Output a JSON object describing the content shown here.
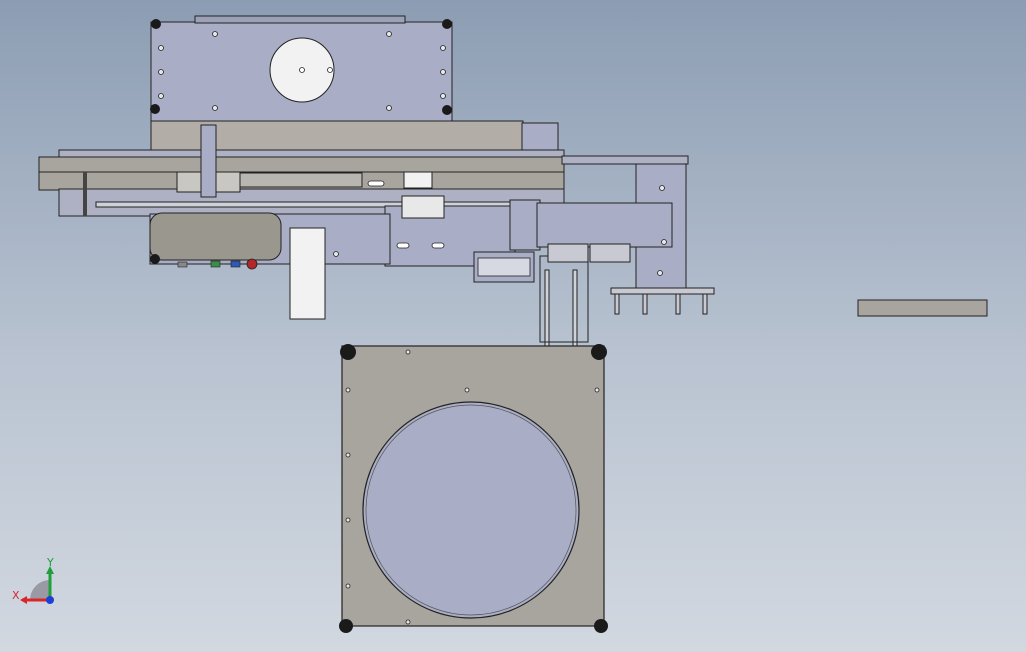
{
  "viewport": {
    "background_top": "#8c9db3",
    "background_bottom": "#d2d8e0"
  },
  "colors": {
    "sheet_metal": "#a9adc6",
    "gray_metal": "#a8a59e",
    "dark_metal": "#9a978f",
    "outline": "#222222",
    "white_part": "#f2f2f2",
    "foot": "#1a1a1a",
    "axis_x": "#d9262b",
    "axis_y": "#1f9e3a",
    "axis_z": "#1d3fd6",
    "button_red": "#b3262a",
    "button_green": "#3c8c4a",
    "button_blue": "#2f59b5"
  },
  "triad": {
    "x_label": "X",
    "y_label": "Y",
    "icon": "coordinate-triad-icon"
  }
}
